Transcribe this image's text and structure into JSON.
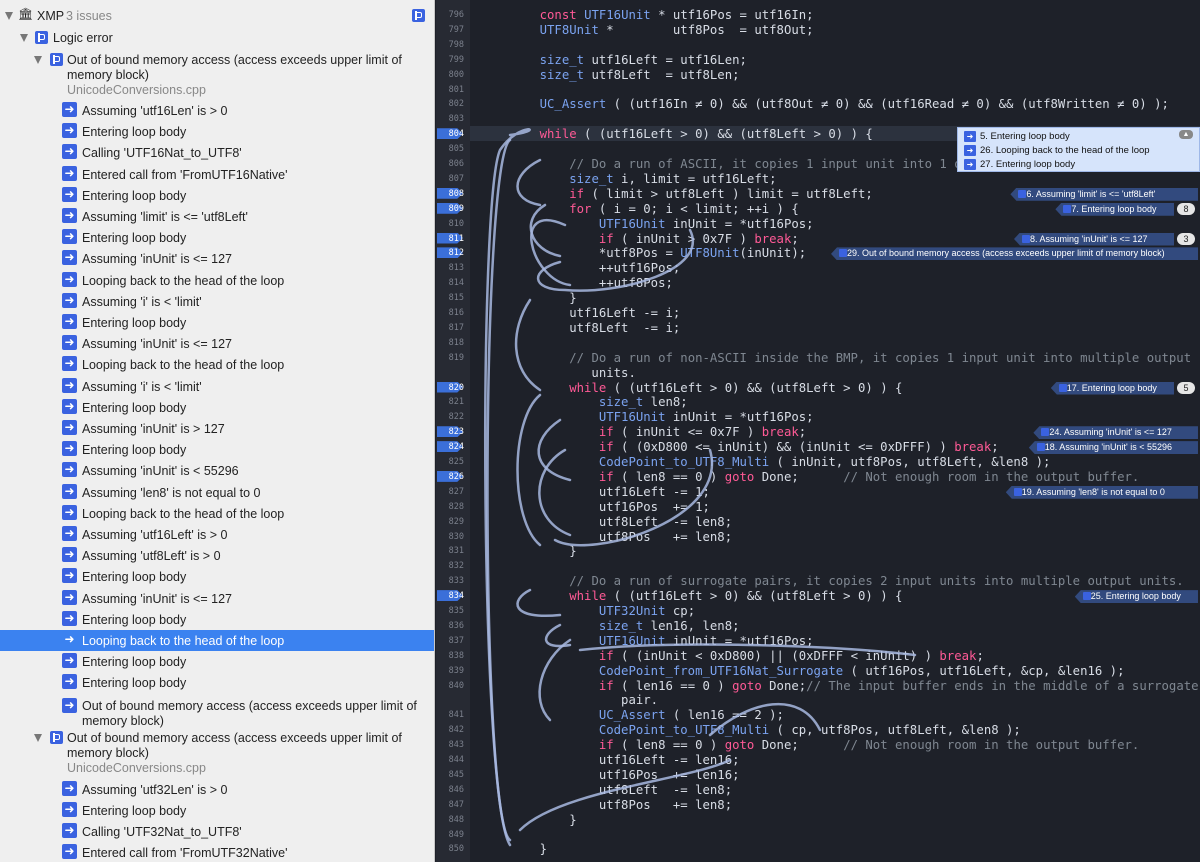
{
  "navigator": {
    "root": {
      "name": "XMP",
      "count": "3 issues"
    },
    "group": "Logic error",
    "issues": [
      {
        "title": "Out of bound memory access (access exceeds upper limit of memory block)",
        "file": "UnicodeConversions.cpp"
      },
      {
        "title": "Out of bound memory access (access exceeds upper limit of memory block)",
        "file": "UnicodeConversions.cpp"
      }
    ],
    "steps_a": [
      "Assuming 'utf16Len' is > 0",
      "Entering loop body",
      "Calling 'UTF16Nat_to_UTF8'",
      "Entered call from 'FromUTF16Native'",
      "Entering loop body",
      "Assuming 'limit' is <= 'utf8Left'",
      "Entering loop body",
      "Assuming 'inUnit' is <= 127",
      "Looping back to the head of the loop",
      "Assuming 'i' is < 'limit'",
      "Entering loop body",
      "Assuming 'inUnit' is <= 127",
      "Looping back to the head of the loop",
      "Assuming 'i' is < 'limit'",
      "Entering loop body",
      "Assuming 'inUnit' is > 127",
      "Entering loop body",
      "Assuming 'inUnit' is < 55296",
      "Assuming 'len8' is not equal to 0",
      "Looping back to the head of the loop",
      "Assuming 'utf16Left' is > 0",
      "Assuming 'utf8Left' is > 0",
      "Entering loop body",
      "Assuming 'inUnit' is <= 127",
      "Entering loop body",
      "Looping back to the head of the loop",
      "Entering loop body",
      "Entering loop body"
    ],
    "final_step": "Out of bound memory access (access exceeds upper limit of memory block)",
    "steps_b": [
      "Assuming 'utf32Len' is > 0",
      "Entering loop body",
      "Calling 'UTF32Nat_to_UTF8'",
      "Entered call from 'FromUTF32Native'"
    ],
    "selected_index": 25
  },
  "editor": {
    "line_numbers": [
      "796",
      "797",
      "798",
      "799",
      "800",
      "801",
      "802",
      "803",
      "804",
      "805",
      "806",
      "807",
      "808",
      "809",
      "810",
      "811",
      "812",
      "813",
      "814",
      "815",
      "816",
      "817",
      "818",
      "819",
      "",
      "820",
      "821",
      "822",
      "823",
      "824",
      "825",
      "826",
      "827",
      "828",
      "829",
      "830",
      "831",
      "832",
      "833",
      "834",
      "835",
      "836",
      "837",
      "838",
      "839",
      "840",
      "",
      "841",
      "842",
      "843",
      "844",
      "845",
      "846",
      "847",
      "848",
      "849",
      "850"
    ],
    "breakpoints": [
      "804",
      "808",
      "809",
      "811",
      "812",
      "820",
      "823",
      "824",
      "826",
      "834"
    ],
    "lines": [
      "    const UTF16Unit * utf16Pos = utf16In;",
      "    UTF8Unit *        utf8Pos  = utf8Out;",
      "",
      "    size_t utf16Left = utf16Len;",
      "    size_t utf8Left  = utf8Len;",
      "",
      "    UC_Assert ( (utf16In ≠ 0) && (utf8Out ≠ 0) && (utf16Read ≠ 0) && (utf8Written ≠ 0) );",
      "",
      "    while ( (utf16Left > 0) && (utf8Left > 0) ) {",
      "",
      "        // Do a run of ASCII, it copies 1 input unit into 1 output unit.",
      "        size_t i, limit = utf16Left;",
      "        if ( limit > utf8Left ) limit = utf8Left;",
      "        for ( i = 0; i < limit; ++i ) {",
      "            UTF16Unit inUnit = *utf16Pos;",
      "            if ( inUnit > 0x7F ) break;",
      "            *utf8Pos = UTF8Unit(inUnit);",
      "            ++utf16Pos;",
      "            ++utf8Pos;",
      "        }",
      "        utf16Left -= i;",
      "        utf8Left  -= i;",
      "",
      "        // Do a run of non-ASCII inside the BMP, it copies 1 input unit into multiple output",
      "           units.",
      "        while ( (utf16Left > 0) && (utf8Left > 0) ) {",
      "            size_t len8;",
      "            UTF16Unit inUnit = *utf16Pos;",
      "            if ( inUnit <= 0x7F ) break;",
      "            if ( (0xD800 <= inUnit) && (inUnit <= 0xDFFF) ) break;",
      "            CodePoint_to_UTF8_Multi ( inUnit, utf8Pos, utf8Left, &len8 );",
      "            if ( len8 == 0 ) goto Done;      // Not enough room in the output buffer.",
      "            utf16Left -= 1;",
      "            utf16Pos  += 1;",
      "            utf8Left  -= len8;",
      "            utf8Pos   += len8;",
      "        }",
      "",
      "        // Do a run of surrogate pairs, it copies 2 input units into multiple output units.",
      "        while ( (utf16Left > 0) && (utf8Left > 0) ) {",
      "            UTF32Unit cp;",
      "            size_t len16, len8;",
      "            UTF16Unit inUnit = *utf16Pos;",
      "            if ( (inUnit < 0xD800) || (0xDFFF < inUnit) ) break;",
      "            CodePoint_from_UTF16Nat_Surrogate ( utf16Pos, utf16Left, &cp, &len16 );",
      "            if ( len16 == 0 ) goto Done;// The input buffer ends in the middle of a surrogate",
      "               pair.",
      "            UC_Assert ( len16 == 2 );",
      "            CodePoint_to_UTF8_Multi ( cp, utf8Pos, utf8Left, &len8 );",
      "            if ( len8 == 0 ) goto Done;      // Not enough room in the output buffer.",
      "            utf16Left -= len16;",
      "            utf16Pos  += len16;",
      "            utf8Left  -= len8;",
      "            utf8Pos   += len8;",
      "        }",
      "",
      "    }"
    ],
    "popup": [
      "5. Entering loop body",
      "26. Looping back to the head of the loop",
      "27. Entering loop body"
    ],
    "annotations": [
      {
        "line": "808",
        "text": "6. Assuming 'limit' is <= 'utf8Left'"
      },
      {
        "line": "809",
        "text": "7. Entering loop body",
        "count": "8"
      },
      {
        "line": "811",
        "text": "8. Assuming 'inUnit' is <= 127",
        "count": "3"
      },
      {
        "line": "812",
        "text": "29. Out of bound memory access (access exceeds upper limit of memory block)"
      },
      {
        "line": "820",
        "text": "17. Entering loop body",
        "count": "5"
      },
      {
        "line": "823",
        "text": "24. Assuming 'inUnit' is <= 127"
      },
      {
        "line": "824",
        "text": "18. Assuming 'inUnit' is < 55296"
      },
      {
        "line": "827",
        "text": "19. Assuming 'len8' is not equal to 0"
      },
      {
        "line": "834",
        "text": "25. Entering loop body"
      }
    ]
  },
  "colors": {
    "accent": "#3a62e0",
    "selection": "#3b82f0",
    "editor_bg": "#1e2129",
    "keyword": "#ff5a96",
    "type": "#7ba3f0",
    "arrow": "#a8b8e0"
  }
}
